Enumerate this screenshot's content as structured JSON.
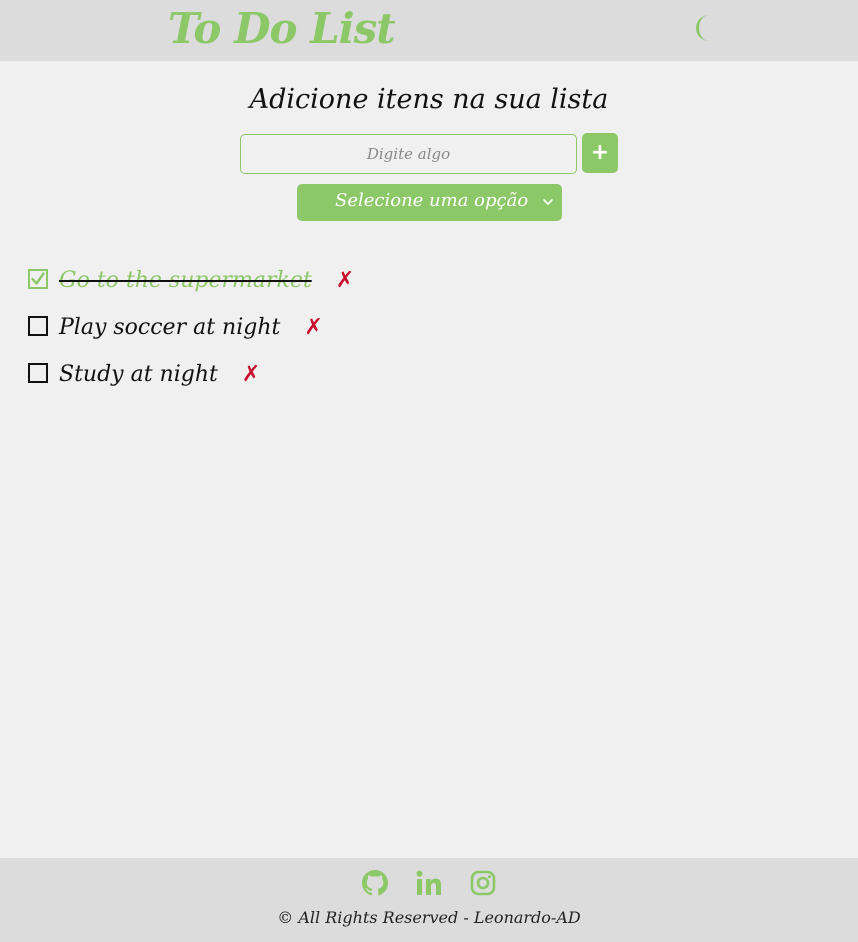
{
  "header": {
    "title": "To Do List",
    "theme_icon": "moon-icon"
  },
  "main": {
    "subtitle": "Adicione itens na sua lista",
    "input_placeholder": "Digite algo",
    "input_value": "",
    "add_label": "+",
    "filter_selected": "Selecione uma opção"
  },
  "todos": [
    {
      "text": "Go to the supermarket",
      "done": true,
      "delete_label": "✗"
    },
    {
      "text": "Play soccer at night",
      "done": false,
      "delete_label": "✗"
    },
    {
      "text": "Study at night",
      "done": false,
      "delete_label": "✗"
    }
  ],
  "footer": {
    "icons": [
      "github-icon",
      "linkedin-icon",
      "instagram-icon"
    ],
    "copyright": "© All Rights Reserved - Leonardo-AD"
  },
  "colors": {
    "accent": "#8cc868",
    "header_bg": "#dcdcdc",
    "page_bg": "#f0f0f0",
    "delete": "#c8102e"
  }
}
